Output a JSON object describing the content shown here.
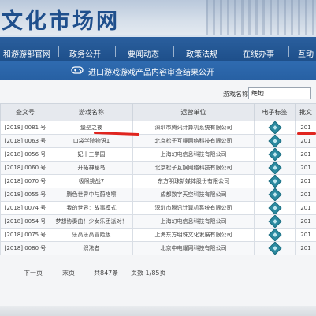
{
  "banner": {
    "title": "文化市场网"
  },
  "nav": {
    "items": [
      "和游游部官网",
      "政务公开",
      "要闻动态",
      "政策法规",
      "在线办事",
      "互动"
    ]
  },
  "subbar": {
    "title": "进口游戏游戏产品内容审查结果公开"
  },
  "search": {
    "label": "游戏名称:",
    "value": "绝地"
  },
  "table": {
    "headers": [
      "查文号",
      "游戏名称",
      "运营单位",
      "电子标签",
      "批文"
    ],
    "rows": [
      {
        "doc": "[2018] 0081 号",
        "name": "堡垒之夜",
        "op": "深圳市腾讯计算机系统有限公司",
        "date": "201"
      },
      {
        "doc": "[2018] 0063 号",
        "name": "口袋学院物语1",
        "op": "北京松子互娱网络科技有限公司",
        "date": "201"
      },
      {
        "doc": "[2018] 0056 号",
        "name": "妃十三学园",
        "op": "上海幻电信息科技有限公司",
        "date": "201"
      },
      {
        "doc": "[2018] 0060 号",
        "name": "开拓神秘岛",
        "op": "北京松子互娱网络科技有限公司",
        "date": "201"
      },
      {
        "doc": "[2018] 0070 号",
        "name": "极限挑战7",
        "op": "东方明珠新媒体股份有限公司",
        "date": "201"
      },
      {
        "doc": "[2018] 0055 号",
        "name": "腾色世界中与蔚咯嚓",
        "op": "成都数字天空科技有限公司",
        "date": "201"
      },
      {
        "doc": "[2018] 0074 号",
        "name": "我的世界：故事模式",
        "op": "深圳市腾讯计算机系统有限公司",
        "date": "201"
      },
      {
        "doc": "[2018] 0054 号",
        "name": "梦想协奏曲！少女乐团派对！",
        "op": "上海幻电信息科技有限公司",
        "date": "201"
      },
      {
        "doc": "[2018] 0075 号",
        "name": "乐高乐高冒险版",
        "op": "上海东方明珠文化发展有限公司",
        "date": "201"
      },
      {
        "doc": "[2018] 0080 号",
        "name": "织法者",
        "op": "北京中电耀网科技有限公司",
        "date": "201"
      }
    ]
  },
  "pager": {
    "next": "下一页",
    "last": "末页",
    "total": "共847条",
    "page": "页数 1/85页"
  },
  "colors": {
    "nav_bg": "#1e4f8a",
    "subbar_bg": "#2760a3",
    "badge": "#2b8aa0",
    "annotation": "#e0251f"
  }
}
